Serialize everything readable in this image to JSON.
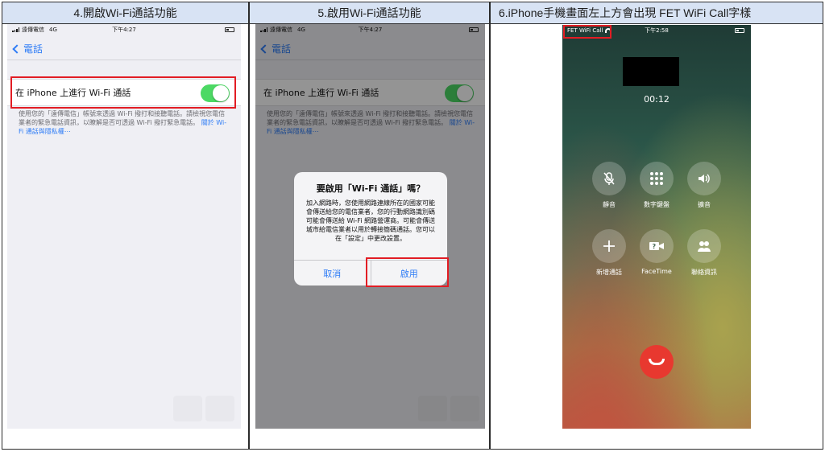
{
  "panels": [
    {
      "header": "4.開啟Wi-Fi通話功能",
      "status": {
        "carrier": "遠傳電信",
        "network": "4G",
        "time": "下午4:27"
      },
      "back_label": "電話",
      "toggle_label": "在 iPhone 上進行 Wi-Fi 通話",
      "toggle_on": true,
      "footer_text": "使用您的「遠傳電信」帳號來透過 Wi-Fi 撥打和接聽電話。請檢視您電信業者的緊急電話資訊，以瞭解是否可透過 Wi-Fi 撥打緊急電話。",
      "footer_link": "關於 Wi-Fi 通話與隱私權⋯"
    },
    {
      "header": "5.啟用Wi-Fi通話功能",
      "status": {
        "carrier": "遠傳電信",
        "network": "4G",
        "time": "下午4:27"
      },
      "back_label": "電話",
      "toggle_label": "在 iPhone 上進行 Wi-Fi 通話",
      "footer_text": "使用您的「遠傳電信」帳號來透過 Wi-Fi 撥打和接聽電話。請檢視您電信業者的緊急電話資訊，以瞭解是否可透過 Wi-Fi 撥打緊急電話。",
      "footer_link": "關於 Wi-Fi 通話與隱私權⋯",
      "alert": {
        "title": "要啟用「Wi-Fi 通話」嗎？",
        "message": "加入網路時，您使用網路連線所在的國家可能會傳送給您的電信業者，您的行動網路識別碼可能會傳送給 Wi-Fi 網路營運商。可能會傳送城市給電信業者以用於轉接簡碼通話。您可以在「設定」中更改設置。",
        "cancel_label": "取消",
        "enable_label": "啟用"
      }
    },
    {
      "header": "6.iPhone手機畫面左上方會出現 FET WiFi Call字樣",
      "status": {
        "carrier_label": "FET WiFi Call",
        "time": "下午2:58"
      },
      "duration": "00:12",
      "keys": [
        {
          "label": "靜音",
          "icon": "mic-off-icon"
        },
        {
          "label": "數字鍵盤",
          "icon": "keypad-icon"
        },
        {
          "label": "擴音",
          "icon": "speaker-icon"
        },
        {
          "label": "新增通話",
          "icon": "plus-icon"
        },
        {
          "label": "FaceTime",
          "icon": "facetime-icon"
        },
        {
          "label": "聯絡資訊",
          "icon": "contacts-icon"
        }
      ],
      "end_call_color": "#e8382f"
    }
  ],
  "colors": {
    "header_bg": "#d8e3f4",
    "highlight": "#e21d24",
    "ios_blue": "#2e7cf6",
    "toggle_green": "#4cd964"
  }
}
